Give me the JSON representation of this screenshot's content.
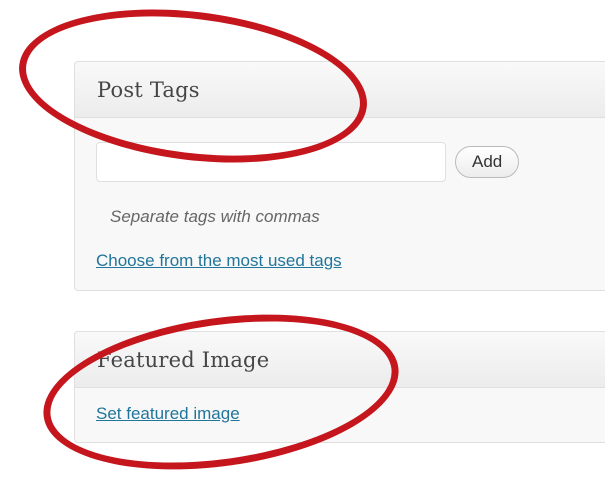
{
  "post_tags": {
    "title": "Post Tags",
    "input_value": "",
    "add_label": "Add",
    "hint": "Separate tags with commas",
    "choose_link": "Choose from the most used tags"
  },
  "featured_image": {
    "title": "Featured Image",
    "set_link": "Set featured image"
  },
  "colors": {
    "highlight_ellipse": "#c4161c",
    "link": "#21759b",
    "box_background": "#f8f8f8",
    "border": "#dfdfdf"
  }
}
